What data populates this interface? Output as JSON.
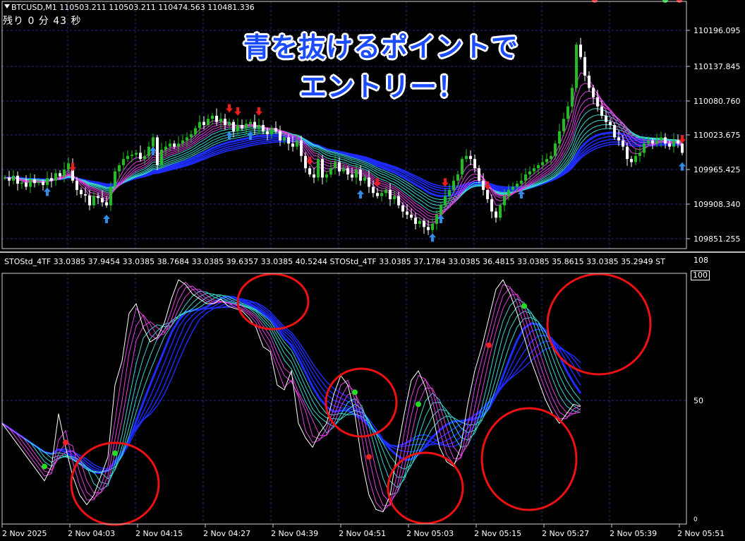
{
  "header": {
    "symbol_line": "BTCUSD,M1  110503.211 110503.211 110474.563 110481.336",
    "timer": "残り 0 分 43 秒"
  },
  "annotation": {
    "line1": "青を抜けるポイントで",
    "line2": "エントリー！"
  },
  "price_axis": [
    "110196.095",
    "110137.845",
    "110080.760",
    "110023.675",
    "109965.425",
    "109908.340",
    "109851.255"
  ],
  "indicator": {
    "header": "STOStd_4TF 33.0385 37.9454 33.0385 38.7684 33.0385 39.6357 33.0385 40.5244  STOStd_4TF 33.0385 37.1784 33.0385 36.4815 33.0385 35.8615 33.0385 35.2949  ST",
    "axis_labels": [
      "108",
      "100",
      "50",
      "0"
    ]
  },
  "time_axis": [
    "2 Nov 2025",
    "2 Nov 04:03",
    "2 Nov 04:15",
    "2 Nov 04:27",
    "2 Nov 04:39",
    "2 Nov 04:51",
    "2 Nov 05:03",
    "2 Nov 05:15",
    "2 Nov 05:27",
    "2 Nov 05:39",
    "2 Nov 05:51"
  ],
  "colors": {
    "background": "#000000",
    "grid": "#2a2a8a",
    "bull_candle": "#1fbf1f",
    "bear_candle": "#ffffff",
    "blue_band": "#1e2cff",
    "cyan_band": "#3ad6d0",
    "magenta_band": "#e040e0",
    "up_arrow": "#2e8ce8",
    "down_arrow": "#ee1c1c",
    "circle": "#ee1111",
    "green_dot": "#22dd22",
    "red_dot": "#ee2222"
  },
  "chart_data": {
    "type": "line",
    "title": "",
    "price_ylim": [
      109830,
      110230
    ],
    "stochastic_ylim": [
      0,
      108
    ],
    "price_x": [
      0,
      6,
      12,
      18,
      24,
      30,
      36,
      42,
      48,
      54,
      60,
      66,
      72,
      78,
      84,
      90,
      96,
      102,
      108,
      114,
      120,
      126,
      132,
      138,
      144,
      150,
      156,
      162,
      168,
      174,
      180,
      186,
      192,
      198,
      204,
      210,
      216,
      222,
      228,
      234,
      240,
      246,
      252,
      258,
      264,
      270,
      276,
      282,
      288,
      294,
      300,
      306,
      312,
      318,
      324,
      330,
      336,
      342,
      348,
      354,
      360,
      366,
      372,
      378,
      384,
      390,
      396,
      402,
      408,
      414,
      420,
      426,
      432,
      438,
      444,
      450,
      456,
      462,
      468,
      474,
      480,
      486,
      492,
      498,
      504,
      510,
      516,
      522,
      528,
      534,
      540,
      546,
      552,
      558,
      564,
      570,
      576,
      582,
      588,
      594,
      600,
      606,
      612,
      618,
      624,
      630,
      636,
      642,
      648,
      654,
      660,
      666,
      672,
      678,
      684,
      690,
      696,
      702,
      708,
      714,
      720,
      726,
      732,
      738,
      744,
      750,
      756,
      762,
      768,
      774,
      780,
      786,
      792,
      798,
      804,
      810,
      816,
      822,
      828,
      834,
      840,
      846,
      852,
      858,
      864,
      870,
      876,
      882,
      888,
      894,
      900,
      906,
      912,
      918,
      924,
      930,
      936,
      942,
      948,
      954,
      960,
      966
    ],
    "price_close": [
      109945,
      109940,
      109948,
      109935,
      109937,
      109930,
      109942,
      109936,
      109938,
      109933,
      109944,
      109940,
      109952,
      109947,
      109958,
      109968,
      109940,
      109925,
      109918,
      109916,
      109900,
      109915,
      109912,
      109905,
      109900,
      109930,
      109955,
      109965,
      109975,
      109980,
      109982,
      109985,
      109975,
      109980,
      109995,
      110010,
      109965,
      109990,
      109995,
      110000,
      109995,
      110000,
      110005,
      110010,
      110015,
      110025,
      110035,
      110030,
      110040,
      110045,
      110035,
      110040,
      110030,
      110035,
      110020,
      110030,
      110025,
      110032,
      110035,
      110025,
      110030,
      110020,
      110015,
      110025,
      110020,
      110005,
      110010,
      110000,
      109995,
      110005,
      109980,
      109960,
      109950,
      109945,
      109975,
      109945,
      109950,
      109960,
      109970,
      109955,
      109960,
      109950,
      109945,
      109958,
      109940,
      109945,
      109930,
      109920,
      109915,
      109920,
      109925,
      109910,
      109915,
      109900,
      109890,
      109885,
      109880,
      109870,
      109875,
      109865,
      109860,
      109870,
      109885,
      109900,
      109915,
      109925,
      109940,
      109950,
      109975,
      109980,
      109975,
      109960,
      109940,
      109925,
      109910,
      109890,
      109880,
      109900,
      109915,
      109925,
      109930,
      109935,
      109940,
      109950,
      109955,
      109960,
      109965,
      109970,
      109975,
      109980,
      110000,
      110020,
      110040,
      110060,
      110090,
      110160,
      110140,
      110110,
      110090,
      110075,
      110060,
      110045,
      110035,
      110030,
      110010,
      110005,
      109995,
      109975,
      109970,
      109980,
      109985,
      110000,
      110005,
      110000,
      110005,
      110010,
      110000,
      109995,
      110005,
      110000,
      109985
    ],
    "stochastic_x": [
      0,
      10,
      20,
      30,
      40,
      50,
      60,
      70,
      80,
      90,
      100,
      110,
      120,
      130,
      140,
      150,
      160,
      170,
      180,
      190,
      200,
      210,
      220,
      230,
      240,
      250,
      260,
      270,
      280,
      290,
      300,
      310,
      320,
      330,
      340,
      350,
      360,
      370,
      380,
      390,
      400,
      410,
      420,
      430,
      440,
      450,
      460,
      470,
      480,
      490,
      500,
      510,
      520,
      530,
      540,
      550,
      560,
      570,
      580,
      590,
      600,
      610,
      620,
      630,
      640,
      650,
      660,
      670,
      680,
      690,
      700,
      710,
      720,
      730,
      740,
      750,
      760,
      770,
      780,
      790,
      800,
      810,
      820,
      830,
      840,
      850,
      860,
      870,
      880,
      890,
      900,
      910,
      920,
      930,
      940,
      950,
      960,
      966
    ],
    "stochastic_fast": [
      40,
      36,
      32,
      28,
      24,
      20,
      16,
      22,
      44,
      30,
      18,
      10,
      6,
      10,
      18,
      26,
      56,
      66,
      86,
      90,
      80,
      74,
      76,
      82,
      92,
      100,
      98,
      94,
      92,
      90,
      90,
      92,
      89,
      88,
      87,
      84,
      80,
      72,
      70,
      56,
      54,
      62,
      40,
      34,
      30,
      36,
      40,
      52,
      60,
      56,
      44,
      24,
      10,
      4,
      3,
      10,
      28,
      44,
      58,
      62,
      55,
      44,
      30,
      24,
      22,
      30,
      48,
      62,
      72,
      84,
      96,
      100,
      94,
      86,
      76,
      66,
      58,
      50,
      44,
      40,
      44,
      48,
      47
    ]
  }
}
